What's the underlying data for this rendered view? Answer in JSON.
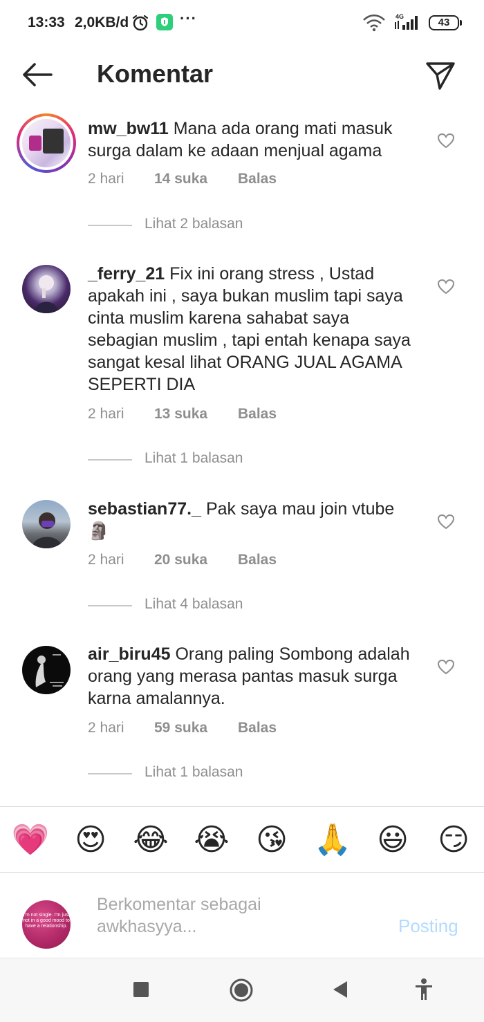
{
  "status_bar": {
    "time": "13:33",
    "speed": "2,0KB/d",
    "dots": "···",
    "network": "4G",
    "battery": "43"
  },
  "header": {
    "title": "Komentar"
  },
  "comments": [
    {
      "username": "mw_bw11",
      "text": "Mana ada orang mati masuk surga dalam ke adaan menjual agama",
      "time": "2 hari",
      "likes": "14 suka",
      "reply": "Balas",
      "replies": "Lihat 2 balasan"
    },
    {
      "username": "_ferry_21",
      "text": "Fix ini orang stress ,  Ustad apakah ini , saya bukan muslim tapi saya cinta muslim karena sahabat saya sebagian muslim , tapi entah kenapa saya sangat kesal lihat ORANG JUAL AGAMA SEPERTI DIA",
      "time": "2 hari",
      "likes": "13 suka",
      "reply": "Balas",
      "replies": "Lihat 1 balasan"
    },
    {
      "username": "sebastian77._",
      "text": "Pak saya mau join vtube 🗿",
      "time": "2 hari",
      "likes": "20 suka",
      "reply": "Balas",
      "replies": "Lihat 4 balasan"
    },
    {
      "username": "air_biru45",
      "text": "Orang paling Sombong adalah orang yang merasa pantas masuk surga karna amalannya.",
      "time": "2 hari",
      "likes": "59 suka",
      "reply": "Balas",
      "replies": "Lihat 1 balasan"
    }
  ],
  "emoji_bar": [
    "💗",
    "😍",
    "😂",
    "😭",
    "😘",
    "🙏",
    "😃",
    "😏"
  ],
  "composer": {
    "placeholder": "Berkomentar sebagai awkhasyya...",
    "post_label": "Posting",
    "avatar_text": "I'm not single. I'm just not in a good mood to have a relationship."
  }
}
